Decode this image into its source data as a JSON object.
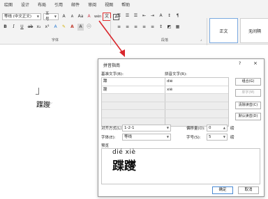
{
  "ribbon_tabs": [
    "绘图",
    "设计",
    "布局",
    "引用",
    "邮件",
    "审阅",
    "视图",
    "帮助"
  ],
  "font": {
    "name": "等线 (中文正文)",
    "size": "五号"
  },
  "group_labels": {
    "font": "字体",
    "paragraph": "段落"
  },
  "styles": {
    "normal": "正文",
    "no_spacing": "无间隔"
  },
  "document": {
    "text": "蹀躞",
    "mark": "↵"
  },
  "dialog": {
    "title": "拼音指南",
    "help": "?",
    "close": "×",
    "base_text_label": "基准文字(B):",
    "ruby_text_label": "拼音文字(R):",
    "rows": [
      {
        "base": "蹀",
        "ruby": "dié"
      },
      {
        "base": "躞",
        "ruby": "xiè"
      },
      {
        "base": "",
        "ruby": ""
      },
      {
        "base": "",
        "ruby": ""
      },
      {
        "base": "",
        "ruby": ""
      },
      {
        "base": "",
        "ruby": ""
      }
    ],
    "buttons": {
      "combine": "组合(G)",
      "single": "单字(M)",
      "clear": "清除读音(C)",
      "default": "默认读音(D)"
    },
    "alignment_label": "对齐方式(L):",
    "alignment_value": "1-2-1",
    "offset_label": "偏移量(O):",
    "offset_value": "0",
    "font_label": "字体(E):",
    "font_value": "等线",
    "size_label": "字号(S):",
    "size_value": "5",
    "unit": "磅",
    "preview_label": "预览",
    "preview_ruby": "dié xiè",
    "preview_base": "蹀躞",
    "ok": "确定",
    "cancel": "取消"
  },
  "colors": {
    "arrow": "#d9262c",
    "highlight": "#e03030"
  }
}
